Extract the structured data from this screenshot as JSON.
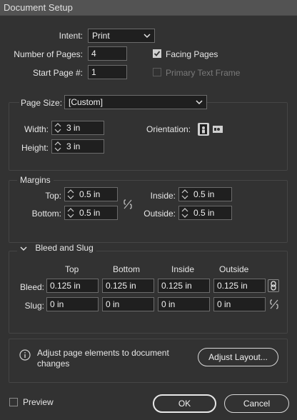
{
  "window": {
    "title": "Document Setup"
  },
  "intent": {
    "label": "Intent:",
    "value": "Print"
  },
  "num_pages": {
    "label": "Number of Pages:",
    "value": "4"
  },
  "start_page": {
    "label": "Start Page #:",
    "value": "1"
  },
  "facing_pages": {
    "label": "Facing Pages",
    "checked": true
  },
  "primary_text_frame": {
    "label": "Primary Text Frame",
    "checked": false,
    "enabled": false
  },
  "page_size": {
    "label": "Page Size:",
    "value": "[Custom]",
    "width_label": "Width:",
    "width": "3 in",
    "height_label": "Height:",
    "height": "3 in",
    "orientation_label": "Orientation:"
  },
  "margins": {
    "title": "Margins",
    "top_label": "Top:",
    "top": "0.5 in",
    "bottom_label": "Bottom:",
    "bottom": "0.5 in",
    "inside_label": "Inside:",
    "inside": "0.5 in",
    "outside_label": "Outside:",
    "outside": "0.5 in"
  },
  "bleed_slug": {
    "title": "Bleed and Slug",
    "columns": [
      "Top",
      "Bottom",
      "Inside",
      "Outside"
    ],
    "bleed_label": "Bleed:",
    "bleed": [
      "0.125 in",
      "0.125 in",
      "0.125 in",
      "0.125 in"
    ],
    "slug_label": "Slug:",
    "slug": [
      "0 in",
      "0 in",
      "0 in",
      "0 in"
    ]
  },
  "adjust": {
    "message": "Adjust page elements to document changes",
    "button": "Adjust Layout..."
  },
  "footer": {
    "preview_label": "Preview",
    "ok": "OK",
    "cancel": "Cancel"
  },
  "colors": {
    "panel": "#323232",
    "titlebar": "#535353",
    "field": "#1f1f1f"
  }
}
